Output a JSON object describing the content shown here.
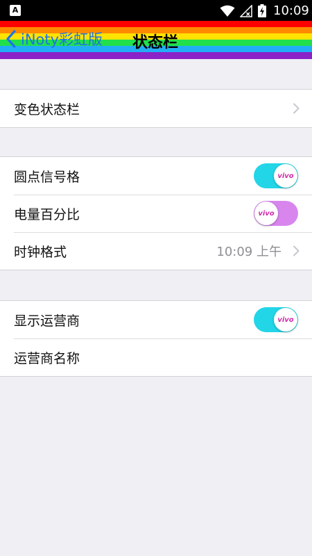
{
  "statusbar": {
    "app_icon_letter": "A",
    "time": "10:09"
  },
  "navbar": {
    "back_label": "iNoty彩虹版",
    "title": "状态栏",
    "rainbow_colors": [
      "#fe0000",
      "#ff8a00",
      "#ffe300",
      "#21e04c",
      "#22aef6",
      "#8b22c8"
    ]
  },
  "groups": [
    {
      "rows": [
        {
          "label": "变色状态栏",
          "type": "disclosure"
        }
      ]
    },
    {
      "rows": [
        {
          "label": "圆点信号格",
          "type": "toggle",
          "on": true
        },
        {
          "label": "电量百分比",
          "type": "toggle",
          "on": false
        },
        {
          "label": "时钟格式",
          "type": "disclosure",
          "value": "10:09 上午"
        }
      ]
    },
    {
      "rows": [
        {
          "label": "显示运营商",
          "type": "toggle",
          "on": true
        },
        {
          "label": "运营商名称",
          "type": "plain"
        }
      ]
    }
  ],
  "toggle": {
    "knob_text": "vivo",
    "on_color": "#22d6e8",
    "off_color": "#d886ee"
  }
}
